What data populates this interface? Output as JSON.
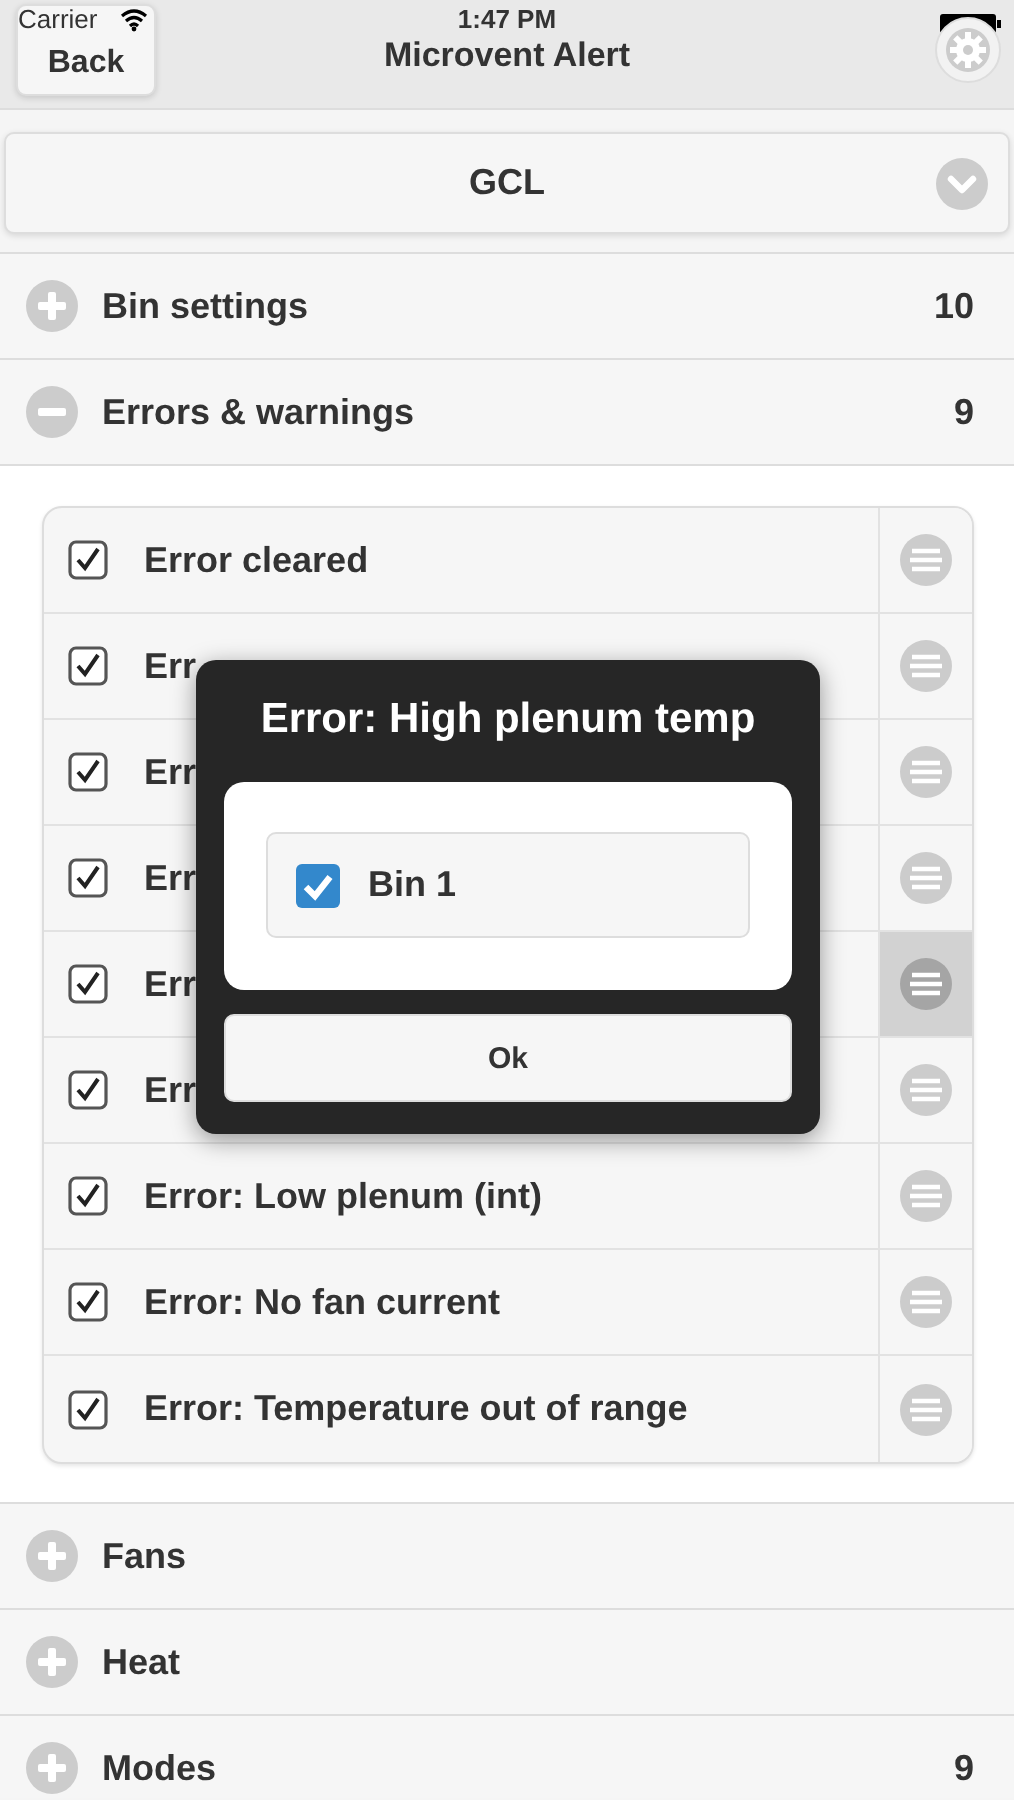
{
  "status_bar": {
    "carrier": "Carrier",
    "time": "1:47 PM"
  },
  "nav_bar": {
    "back": "Back",
    "title": "Microvent Alert"
  },
  "selector": {
    "value": "GCL"
  },
  "sections": [
    {
      "title": "Bin settings",
      "count": "10",
      "expanded": false
    },
    {
      "title": "Errors & warnings",
      "count": "9",
      "expanded": true,
      "items": [
        {
          "label": "Error cleared",
          "checked": true,
          "selected": false
        },
        {
          "label": "Err",
          "checked": true,
          "selected": false
        },
        {
          "label": "Err",
          "checked": true,
          "selected": false
        },
        {
          "label": "Err",
          "checked": true,
          "selected": false
        },
        {
          "label": "Err",
          "checked": true,
          "selected": true
        },
        {
          "label": "Err",
          "checked": true,
          "selected": false
        },
        {
          "label": "Error: Low plenum (int)",
          "checked": true,
          "selected": false
        },
        {
          "label": "Error: No fan current",
          "checked": true,
          "selected": false
        },
        {
          "label": "Error: Temperature out of range",
          "checked": true,
          "selected": false
        }
      ]
    },
    {
      "title": "Fans",
      "expanded": false
    },
    {
      "title": "Heat",
      "expanded": false
    },
    {
      "title": "Modes",
      "count": "9",
      "expanded": false
    }
  ],
  "dialog": {
    "title": "Error: High plenum temp",
    "options": [
      {
        "label": "Bin 1",
        "checked": true
      }
    ],
    "button": "Ok"
  }
}
